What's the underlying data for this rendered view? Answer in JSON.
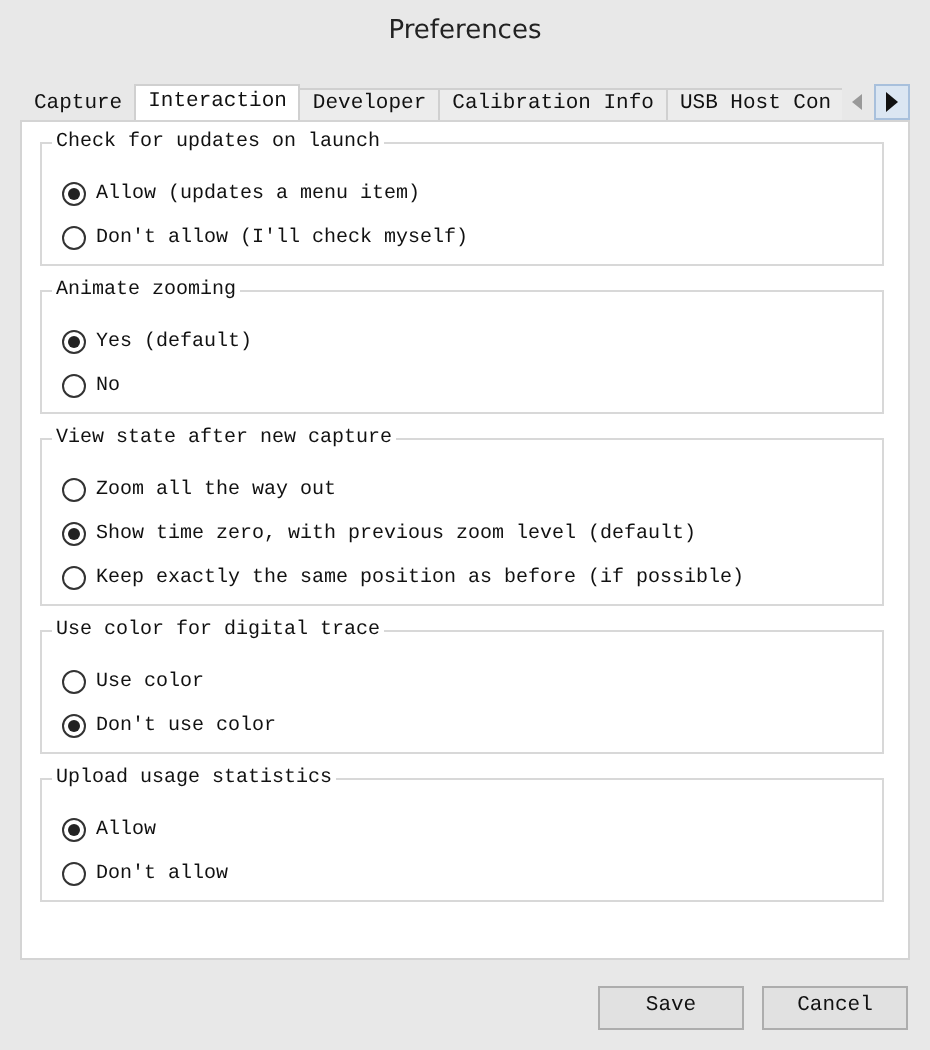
{
  "window": {
    "title": "Preferences"
  },
  "tabs": [
    {
      "label": "Capture",
      "selected": false
    },
    {
      "label": "Interaction",
      "selected": true
    },
    {
      "label": "Developer",
      "selected": false
    },
    {
      "label": "Calibration Info",
      "selected": false
    },
    {
      "label": "USB Host Con",
      "selected": false
    }
  ],
  "groups": [
    {
      "title": "Check for updates on launch",
      "options": [
        {
          "label": "Allow (updates a menu item)",
          "selected": true
        },
        {
          "label": "Don't allow (I'll check myself)",
          "selected": false
        }
      ]
    },
    {
      "title": "Animate zooming",
      "options": [
        {
          "label": "Yes (default)",
          "selected": true
        },
        {
          "label": "No",
          "selected": false
        }
      ]
    },
    {
      "title": "View state after new capture",
      "options": [
        {
          "label": "Zoom all the way out",
          "selected": false
        },
        {
          "label": "Show time zero, with previous zoom level (default)",
          "selected": true
        },
        {
          "label": "Keep exactly the same position as before (if possible)",
          "selected": false
        }
      ]
    },
    {
      "title": "Use color for digital trace",
      "options": [
        {
          "label": "Use color",
          "selected": false
        },
        {
          "label": "Don't use color",
          "selected": true
        }
      ]
    },
    {
      "title": "Upload usage statistics",
      "options": [
        {
          "label": "Allow",
          "selected": true
        },
        {
          "label": "Don't allow",
          "selected": false
        }
      ]
    }
  ],
  "buttons": [
    "Save",
    "Cancel"
  ]
}
